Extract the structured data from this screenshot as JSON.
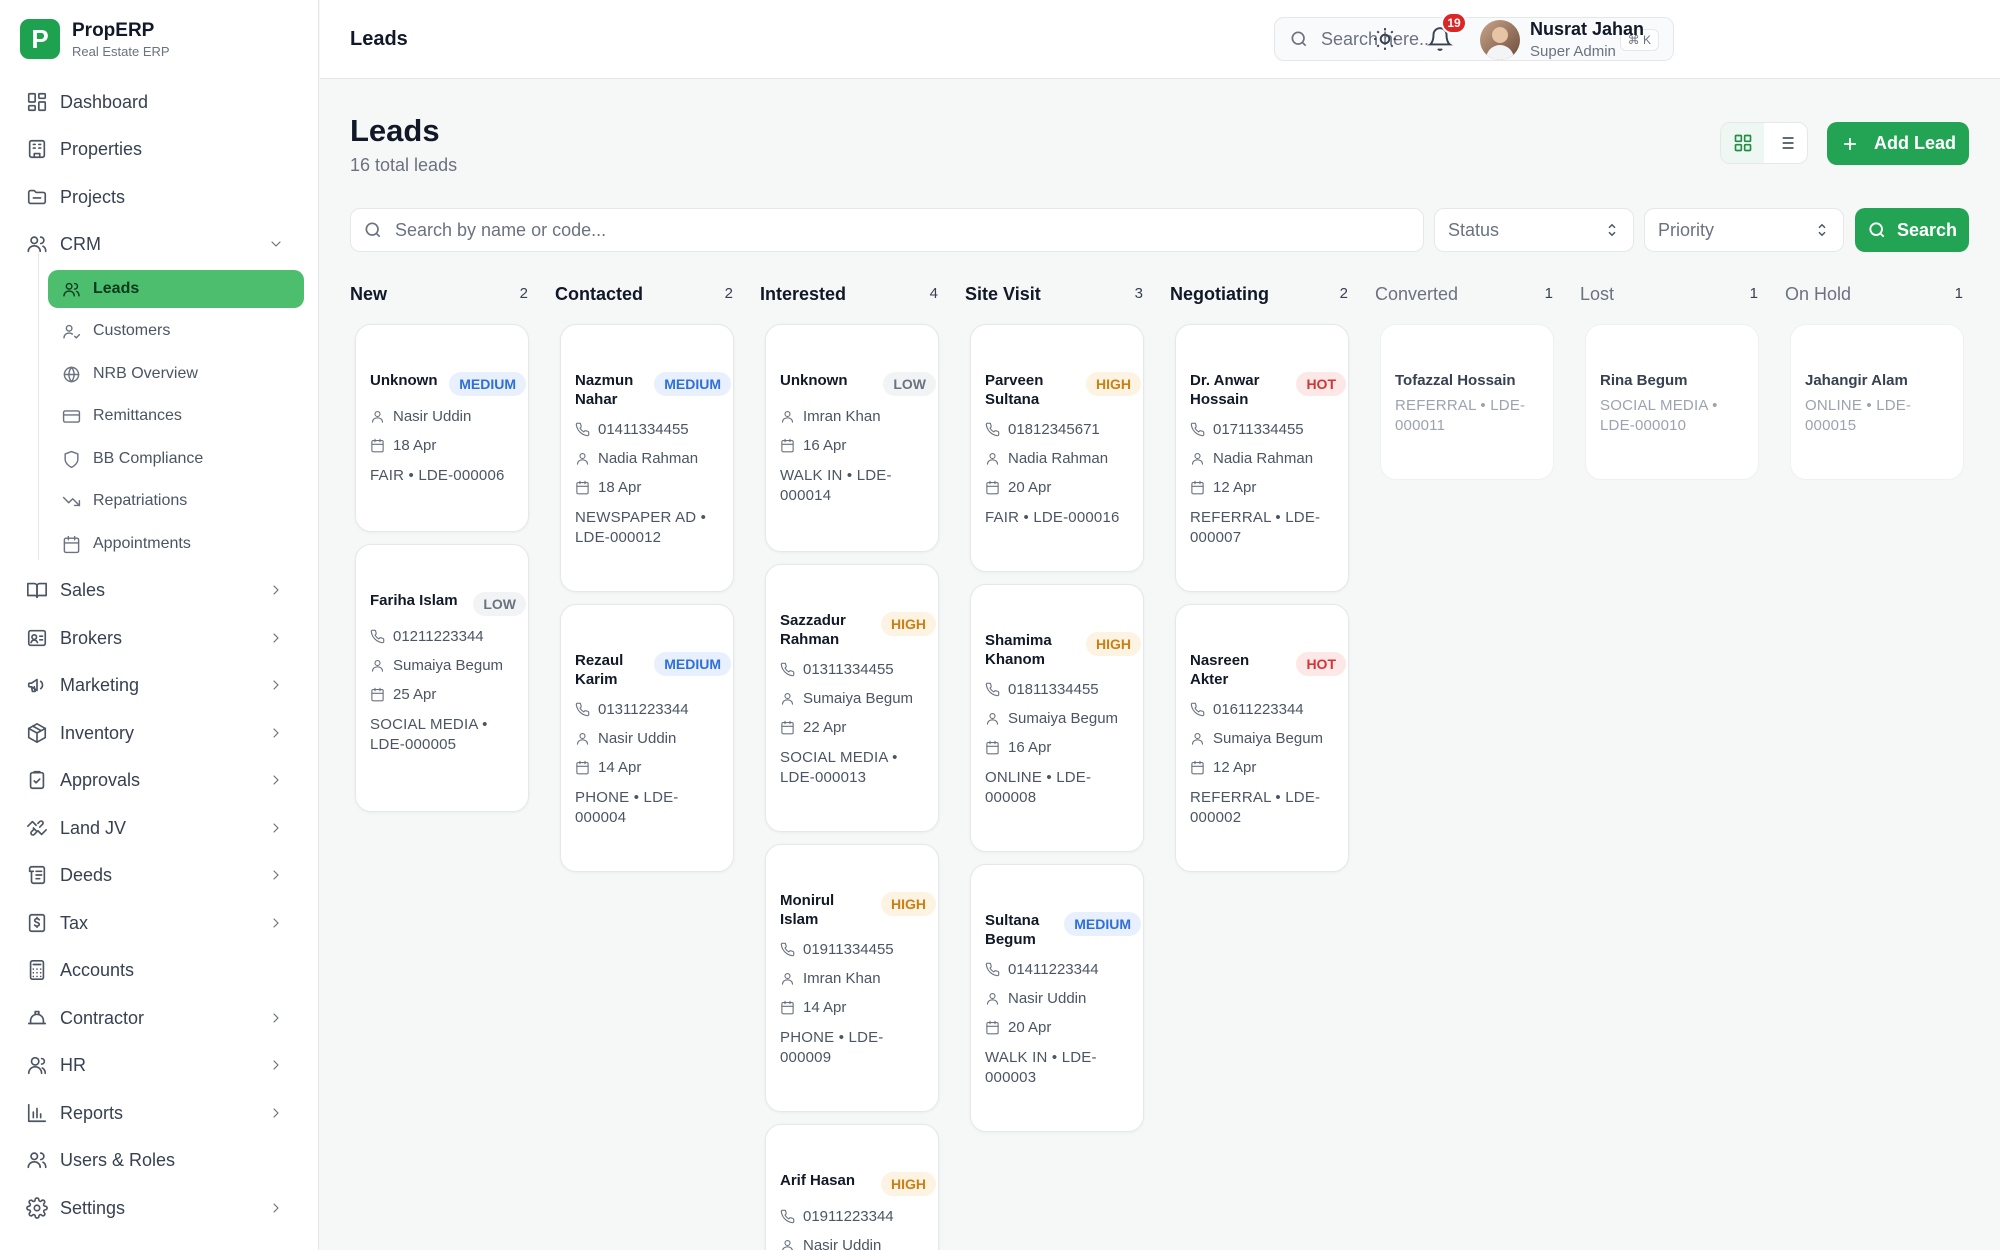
{
  "brand": {
    "name": "PropERP",
    "subtitle": "Real Estate ERP",
    "logo_letter": "P",
    "color": "#1fa24f"
  },
  "sidebar": {
    "items": [
      {
        "label": "Dashboard",
        "icon": "dashboard-icon"
      },
      {
        "label": "Properties",
        "icon": "building-icon"
      },
      {
        "label": "Projects",
        "icon": "folder-icon"
      },
      {
        "label": "CRM",
        "icon": "users-icon",
        "expanded": true
      },
      {
        "label": "Sales",
        "icon": "book-icon"
      },
      {
        "label": "Brokers",
        "icon": "id-card-icon"
      },
      {
        "label": "Marketing",
        "icon": "megaphone-icon"
      },
      {
        "label": "Inventory",
        "icon": "package-icon"
      },
      {
        "label": "Approvals",
        "icon": "clipboard-check-icon"
      },
      {
        "label": "Land JV",
        "icon": "handshake-icon"
      },
      {
        "label": "Deeds",
        "icon": "scroll-icon"
      },
      {
        "label": "Tax",
        "icon": "dollar-receipt-icon"
      },
      {
        "label": "Accounts",
        "icon": "calculator-icon"
      },
      {
        "label": "Contractor",
        "icon": "hard-hat-icon"
      },
      {
        "label": "HR",
        "icon": "user-group-icon"
      },
      {
        "label": "Reports",
        "icon": "bar-chart-icon"
      },
      {
        "label": "Users & Roles",
        "icon": "user-shield-icon"
      },
      {
        "label": "Settings",
        "icon": "gear-icon"
      }
    ],
    "crm_sub": [
      {
        "label": "Leads",
        "icon": "users-icon",
        "active": true
      },
      {
        "label": "Customers",
        "icon": "user-check-icon"
      },
      {
        "label": "NRB Overview",
        "icon": "globe-icon"
      },
      {
        "label": "Remittances",
        "icon": "credit-card-icon"
      },
      {
        "label": "BB Compliance",
        "icon": "shield-icon"
      },
      {
        "label": "Repatriations",
        "icon": "trend-down-icon"
      },
      {
        "label": "Appointments",
        "icon": "calendar-icon"
      }
    ]
  },
  "header": {
    "title": "Leads",
    "search_placeholder": "Search here...",
    "shortcut": "⌘ K",
    "notification_count": "19",
    "user_name": "Nusrat Jahan",
    "user_role": "Super Admin"
  },
  "page": {
    "title": "Leads",
    "subtitle": "16 total leads",
    "add_label": "Add Lead",
    "filter_placeholder": "Search by name or code...",
    "status_label": "Status",
    "priority_label": "Priority",
    "search_label": "Search"
  },
  "columns": [
    {
      "name": "New",
      "count": "2",
      "cards": [
        {
          "name": "Unknown",
          "priority": "MEDIUM",
          "agent": "Nasir Uddin",
          "date": "18 Apr",
          "meta": "FAIR • LDE-000006"
        },
        {
          "name": "Fariha Islam",
          "priority": "LOW",
          "phone": "01211223344",
          "agent": "Sumaiya Begum",
          "date": "25 Apr",
          "meta": "SOCIAL MEDIA • LDE-000005"
        }
      ]
    },
    {
      "name": "Contacted",
      "count": "2",
      "cards": [
        {
          "name": "Nazmun Nahar",
          "priority": "MEDIUM",
          "phone": "01411334455",
          "agent": "Nadia Rahman",
          "date": "18 Apr",
          "meta": "NEWSPAPER AD • LDE-000012"
        },
        {
          "name": "Rezaul Karim",
          "priority": "MEDIUM",
          "phone": "01311223344",
          "agent": "Nasir Uddin",
          "date": "14 Apr",
          "meta": "PHONE • LDE-000004"
        }
      ]
    },
    {
      "name": "Interested",
      "count": "4",
      "cards": [
        {
          "name": "Unknown",
          "priority": "LOW",
          "agent": "Imran Khan",
          "date": "16 Apr",
          "meta": "WALK IN • LDE-000014"
        },
        {
          "name": "Sazzadur Rahman",
          "priority": "HIGH",
          "phone": "01311334455",
          "agent": "Sumaiya Begum",
          "date": "22 Apr",
          "meta": "SOCIAL MEDIA • LDE-000013"
        },
        {
          "name": "Monirul Islam",
          "priority": "HIGH",
          "phone": "01911334455",
          "agent": "Imran Khan",
          "date": "14 Apr",
          "meta": "PHONE • LDE-000009"
        },
        {
          "name": "Arif Hasan",
          "priority": "HIGH",
          "phone": "01911223344",
          "agent": "Nasir Uddin"
        }
      ]
    },
    {
      "name": "Site Visit",
      "count": "3",
      "cards": [
        {
          "name": "Parveen Sultana",
          "priority": "HIGH",
          "phone": "01812345671",
          "agent": "Nadia Rahman",
          "date": "20 Apr",
          "meta": "FAIR • LDE-000016"
        },
        {
          "name": "Shamima Khanom",
          "priority": "HIGH",
          "phone": "01811334455",
          "agent": "Sumaiya Begum",
          "date": "16 Apr",
          "meta": "ONLINE • LDE-000008"
        },
        {
          "name": "Sultana Begum",
          "priority": "MEDIUM",
          "phone": "01411223344",
          "agent": "Nasir Uddin",
          "date": "20 Apr",
          "meta": "WALK IN • LDE-000003"
        }
      ]
    },
    {
      "name": "Negotiating",
      "count": "2",
      "cards": [
        {
          "name": "Dr. Anwar Hossain",
          "priority": "HOT",
          "phone": "01711334455",
          "agent": "Nadia Rahman",
          "date": "12 Apr",
          "meta": "REFERRAL • LDE-000007"
        },
        {
          "name": "Nasreen Akter",
          "priority": "HOT",
          "phone": "01611223344",
          "agent": "Sumaiya Begum",
          "date": "12 Apr",
          "meta": "REFERRAL • LDE-000002"
        }
      ]
    },
    {
      "name": "Converted",
      "count": "1",
      "cards": [
        {
          "name": "Tofazzal Hossain",
          "meta": "REFERRAL • LDE-000011"
        }
      ]
    },
    {
      "name": "Lost",
      "count": "1",
      "cards": [
        {
          "name": "Rina Begum",
          "meta": "SOCIAL MEDIA • LDE-000010"
        }
      ]
    },
    {
      "name": "On Hold",
      "count": "1",
      "cards": [
        {
          "name": "Jahangir Alam",
          "meta": "ONLINE • LDE-000015"
        }
      ]
    }
  ]
}
